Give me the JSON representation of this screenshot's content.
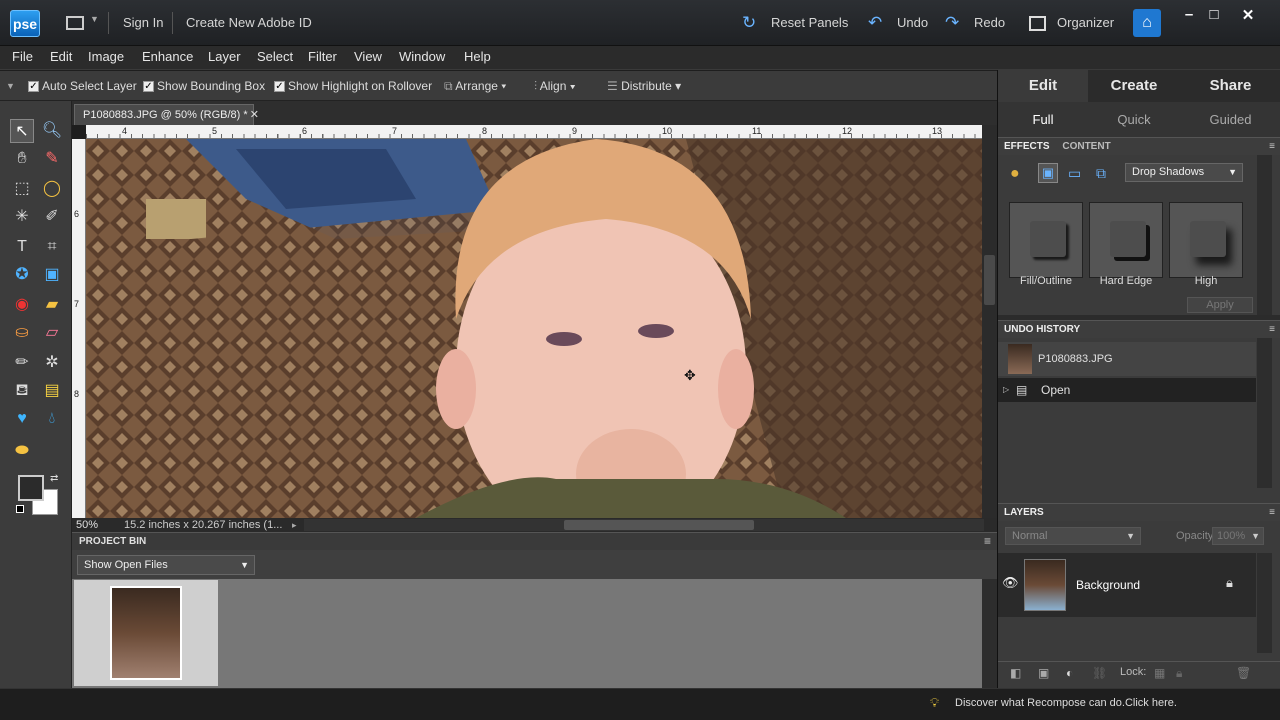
{
  "titlebar": {
    "logo": "pse",
    "sign_in": "Sign In",
    "create_id": "Create New Adobe ID",
    "reset_panels": "Reset Panels",
    "undo": "Undo",
    "redo": "Redo",
    "organizer": "Organizer",
    "minimize": "–",
    "maximize": "□",
    "close": "✕"
  },
  "menu": [
    "File",
    "Edit",
    "Image",
    "Enhance",
    "Layer",
    "Select",
    "Filter",
    "View",
    "Window",
    "Help"
  ],
  "options": {
    "auto_select": "Auto Select Layer",
    "show_bbox": "Show Bounding Box",
    "show_highlight": "Show Highlight on Rollover",
    "arrange": "Arrange",
    "align": "Align",
    "distribute": "Distribute"
  },
  "document": {
    "tab_title": "P1080883.JPG @ 50% (RGB/8) *",
    "zoom": "50%",
    "size_info": "15.2 inches x 20.267 inches (1...",
    "ruler_top": [
      "4",
      "5",
      "6",
      "7",
      "8",
      "9",
      "10",
      "11",
      "12",
      "13"
    ],
    "ruler_left": [
      "6",
      "7",
      "8"
    ]
  },
  "project_bin": {
    "title": "PROJECT BIN",
    "dropdown": "Show Open Files"
  },
  "right_panel": {
    "tabs": [
      "Edit",
      "Create",
      "Share"
    ],
    "subtabs": [
      "Full",
      "Quick",
      "Guided"
    ],
    "effects": {
      "tab_effects": "EFFECTS",
      "tab_content": "CONTENT",
      "dropdown": "Drop Shadows",
      "swatches": [
        "Fill/Outline",
        "Hard Edge",
        "High"
      ],
      "apply": "Apply"
    },
    "undo_history": {
      "title": "UNDO HISTORY",
      "items": [
        "P1080883.JPG",
        "Open"
      ]
    },
    "layers": {
      "title": "LAYERS",
      "blend_mode": "Normal",
      "opacity_label": "Opacity:",
      "opacity_value": "100%",
      "layer_name": "Background",
      "lock_label": "Lock:"
    }
  },
  "tip": "Discover what Recompose can do.Click here."
}
